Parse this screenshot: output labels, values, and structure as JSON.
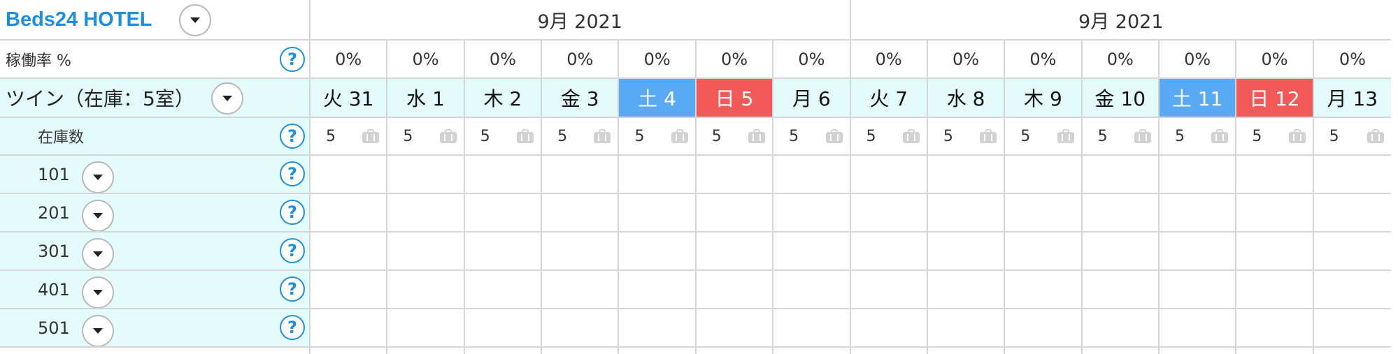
{
  "header": {
    "hotel_name": "Beds24 HOTEL",
    "month_labels": [
      "9月 2021",
      "9月 2021"
    ]
  },
  "occupancy_row": {
    "label": "稼働率 %",
    "values": [
      "0%",
      "0%",
      "0%",
      "0%",
      "0%",
      "0%",
      "0%",
      "0%",
      "0%",
      "0%",
      "0%",
      "0%",
      "0%",
      "0%"
    ]
  },
  "room_type": {
    "label": "ツイン（在庫：5室）",
    "days": [
      {
        "label": "火 31",
        "kind": "weekday"
      },
      {
        "label": "水 1",
        "kind": "weekday"
      },
      {
        "label": "木 2",
        "kind": "weekday"
      },
      {
        "label": "金 3",
        "kind": "weekday"
      },
      {
        "label": "土 4",
        "kind": "saturday"
      },
      {
        "label": "日 5",
        "kind": "sunday"
      },
      {
        "label": "月 6",
        "kind": "weekday"
      },
      {
        "label": "火 7",
        "kind": "weekday"
      },
      {
        "label": "水 8",
        "kind": "weekday"
      },
      {
        "label": "木 9",
        "kind": "weekday"
      },
      {
        "label": "金 10",
        "kind": "weekday"
      },
      {
        "label": "土 11",
        "kind": "saturday"
      },
      {
        "label": "日 12",
        "kind": "sunday"
      },
      {
        "label": "月 13",
        "kind": "weekday"
      }
    ]
  },
  "inventory_row": {
    "label": "在庫数",
    "values": [
      "5",
      "5",
      "5",
      "5",
      "5",
      "5",
      "5",
      "5",
      "5",
      "5",
      "5",
      "5",
      "5",
      "5"
    ],
    "icon": "suitcase-icon"
  },
  "rooms": [
    {
      "number": "101"
    },
    {
      "number": "201"
    },
    {
      "number": "301"
    },
    {
      "number": "401"
    },
    {
      "number": "501"
    }
  ],
  "help_symbol": "?",
  "colors": {
    "accent": "#1e8fd8",
    "saturday": "#5aa9f5",
    "sunday": "#f25a5a",
    "aqua": "#e4fbfb"
  }
}
